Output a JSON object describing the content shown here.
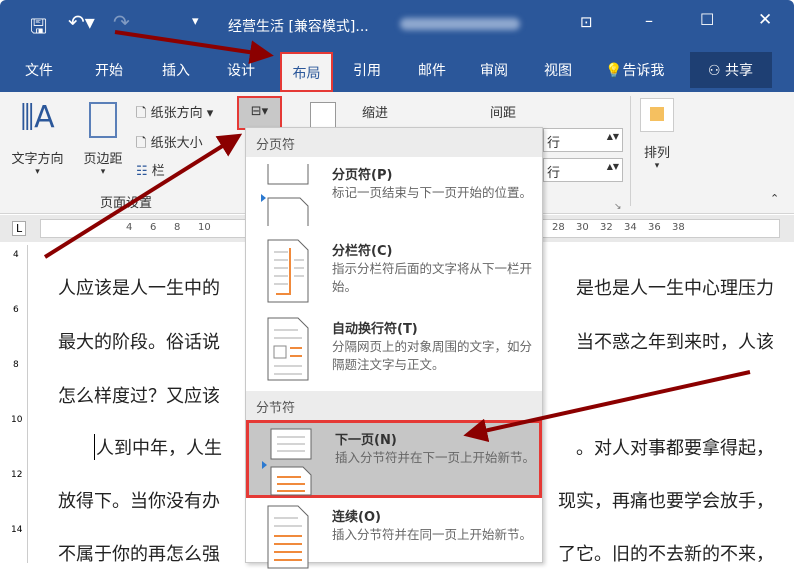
{
  "titlebar": {
    "title": "经营生活 [兼容模式]...",
    "icons": [
      "save-icon",
      "undo-icon",
      "redo-icon",
      "customize-icon",
      "ribbon-display-icon",
      "minimize-icon",
      "maximize-icon",
      "close-icon"
    ]
  },
  "tabs": [
    {
      "label": "文件"
    },
    {
      "label": "开始"
    },
    {
      "label": "插入"
    },
    {
      "label": "设计"
    },
    {
      "label": "布局",
      "active": true
    },
    {
      "label": "引用"
    },
    {
      "label": "邮件"
    },
    {
      "label": "审阅"
    },
    {
      "label": "视图"
    },
    {
      "label": "告诉我"
    }
  ],
  "share": "共享",
  "ribbon": {
    "text_direction": "文字方向",
    "margins": "页边距",
    "orientation": "纸张方向",
    "size": "纸张大小",
    "columns": "栏",
    "group_page_setup": "页面设置",
    "indent": "缩进",
    "spacing": "间距",
    "indent_unit": "行",
    "spacing_unit": "行",
    "arrange": "排列"
  },
  "ruler": [
    "4",
    "6",
    "8",
    "10",
    "28",
    "30",
    "32",
    "34",
    "36",
    "38"
  ],
  "vruler": [
    "4",
    "6",
    "8",
    "10",
    "12",
    "14"
  ],
  "document": {
    "left": [
      "人应该是人一生中的",
      "最大的阶段。俗话说",
      "怎么样度过？又应该",
      "人到中年，人生",
      "放得下。当你没有办",
      "不属于你的再怎么强"
    ],
    "right": [
      "是也是人一生中心理压力",
      "当不惑之年到来时，人该",
      "",
      "。对人对事都要拿得起，",
      "现实，再痛也要学会放手，",
      "了它。旧的不去新的不来，"
    ]
  },
  "menu": {
    "section1": "分页符",
    "section2": "分节符",
    "items": [
      {
        "title": "分页符(P)",
        "desc": "标记一页结束与下一页开始的位置。"
      },
      {
        "title": "分栏符(C)",
        "desc": "指示分栏符后面的文字将从下一栏开始。"
      },
      {
        "title": "自动换行符(T)",
        "desc": "分隔网页上的对象周围的文字，如分隔题注文字与正文。"
      },
      {
        "title": "下一页(N)",
        "desc": "插入分节符并在下一页上开始新节。",
        "highlighted": true
      },
      {
        "title": "连续(O)",
        "desc": "插入分节符并在同一页上开始新节。"
      }
    ]
  },
  "colors": {
    "brand": "#2b579a",
    "highlight": "#e53935",
    "arrow": "#8b0000",
    "accent_orange": "#f08a3c"
  }
}
